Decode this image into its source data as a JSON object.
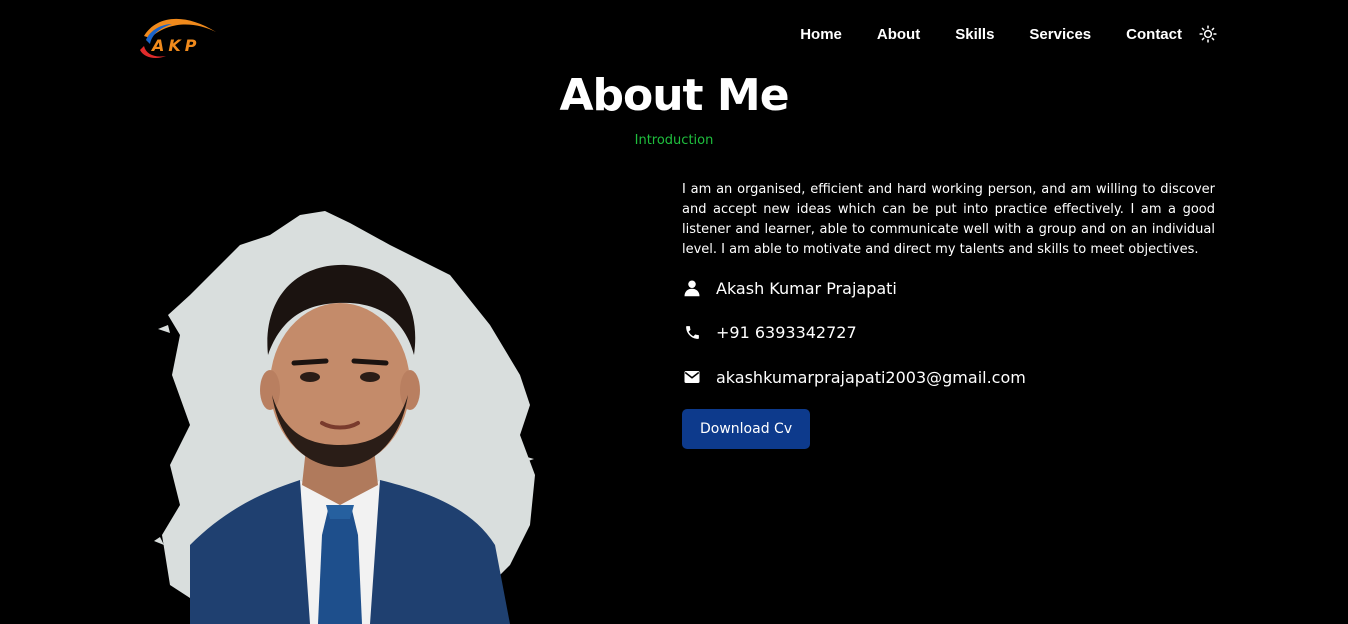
{
  "header": {
    "logo_text": "AKP",
    "nav": [
      {
        "label": "Home"
      },
      {
        "label": "About"
      },
      {
        "label": "Skills"
      },
      {
        "label": "Services"
      },
      {
        "label": "Contact"
      }
    ],
    "theme_icon": "sun-icon"
  },
  "about": {
    "title": "About Me",
    "subtitle": "Introduction",
    "description": "I am an organised, efficient and hard working person, and am willing to discover and accept new ideas which can be put into practice effectively. I am a good listener and learner, able to communicate well with a group and on an individual level. I am able to motivate and direct my talents and skills to meet objectives.",
    "name": "Akash Kumar Prajapati",
    "phone": "+91 6393342727",
    "email": "akashkumarprajapati2003@gmail.com",
    "download_label": "Download Cv"
  },
  "colors": {
    "background": "#000000",
    "accent_green": "#1fbf3e",
    "button_blue": "#0d3a8c",
    "logo_orange": "#f08a1c",
    "logo_blue": "#1a63c9",
    "logo_red": "#e02b2b"
  }
}
